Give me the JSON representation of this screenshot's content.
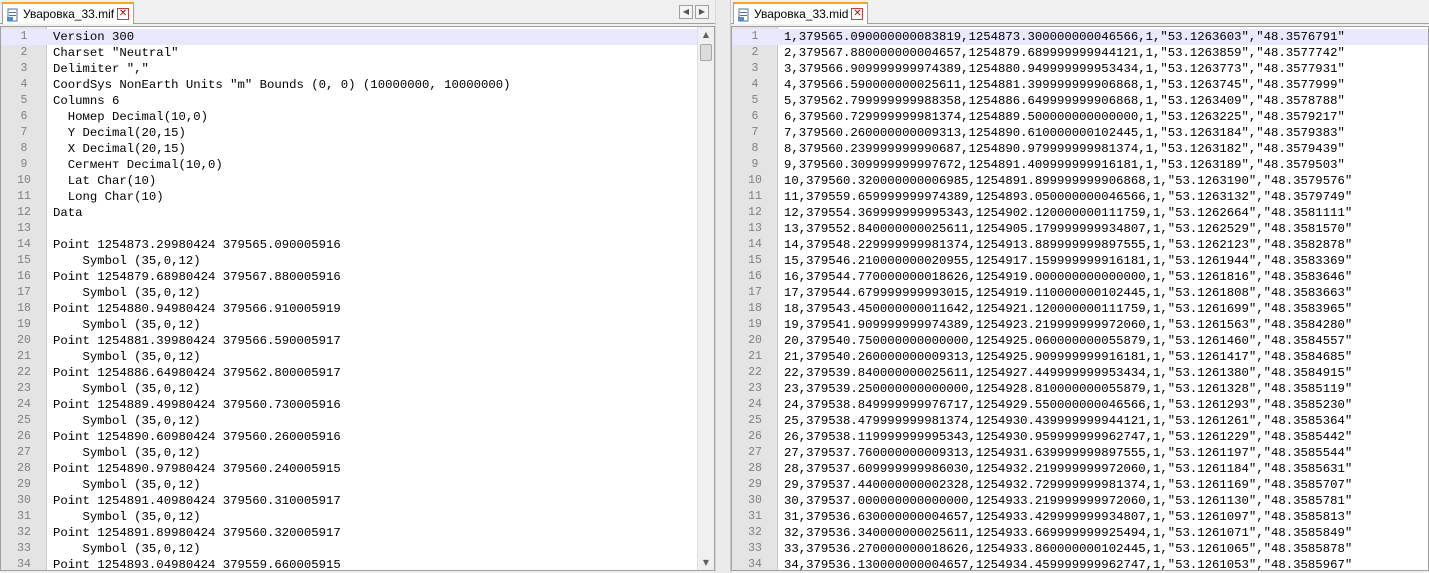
{
  "left_pane": {
    "tab_title": "Уваровка_33.mif",
    "close_glyph": "✕",
    "nav_prev": "◀",
    "nav_next": "▶",
    "scroll_up": "▲",
    "scroll_down": "▼",
    "lines": [
      {
        "n": "1",
        "text": "Version 300"
      },
      {
        "n": "2",
        "text": "Charset \"Neutral\""
      },
      {
        "n": "3",
        "text": "Delimiter \",\""
      },
      {
        "n": "4",
        "text": "CoordSys NonEarth Units \"m\" Bounds (0, 0) (10000000, 10000000)"
      },
      {
        "n": "5",
        "text": "Columns 6"
      },
      {
        "n": "6",
        "text": "  Номер Decimal(10,0)"
      },
      {
        "n": "7",
        "text": "  Y Decimal(20,15)"
      },
      {
        "n": "8",
        "text": "  X Decimal(20,15)"
      },
      {
        "n": "9",
        "text": "  Сегмент Decimal(10,0)"
      },
      {
        "n": "10",
        "text": "  Lat Char(10)"
      },
      {
        "n": "11",
        "text": "  Long Char(10)"
      },
      {
        "n": "12",
        "text": "Data"
      },
      {
        "n": "13",
        "text": ""
      },
      {
        "n": "14",
        "text": "Point 1254873.29980424 379565.090005916"
      },
      {
        "n": "15",
        "text": "    Symbol (35,0,12)"
      },
      {
        "n": "16",
        "text": "Point 1254879.68980424 379567.880005916"
      },
      {
        "n": "17",
        "text": "    Symbol (35,0,12)"
      },
      {
        "n": "18",
        "text": "Point 1254880.94980424 379566.910005919"
      },
      {
        "n": "19",
        "text": "    Symbol (35,0,12)"
      },
      {
        "n": "20",
        "text": "Point 1254881.39980424 379566.590005917"
      },
      {
        "n": "21",
        "text": "    Symbol (35,0,12)"
      },
      {
        "n": "22",
        "text": "Point 1254886.64980424 379562.800005917"
      },
      {
        "n": "23",
        "text": "    Symbol (35,0,12)"
      },
      {
        "n": "24",
        "text": "Point 1254889.49980424 379560.730005916"
      },
      {
        "n": "25",
        "text": "    Symbol (35,0,12)"
      },
      {
        "n": "26",
        "text": "Point 1254890.60980424 379560.260005916"
      },
      {
        "n": "27",
        "text": "    Symbol (35,0,12)"
      },
      {
        "n": "28",
        "text": "Point 1254890.97980424 379560.240005915"
      },
      {
        "n": "29",
        "text": "    Symbol (35,0,12)"
      },
      {
        "n": "30",
        "text": "Point 1254891.40980424 379560.310005917"
      },
      {
        "n": "31",
        "text": "    Symbol (35,0,12)"
      },
      {
        "n": "32",
        "text": "Point 1254891.89980424 379560.320005917"
      },
      {
        "n": "33",
        "text": "    Symbol (35,0,12)"
      },
      {
        "n": "34",
        "text": "Point 1254893.04980424 379559.660005915"
      }
    ]
  },
  "right_pane": {
    "tab_title": "Уваровка_33.mid",
    "close_glyph": "✕",
    "lines": [
      {
        "n": "1",
        "text": "1,379565.090000000083819,1254873.300000000046566,1,\"53.1263603\",\"48.3576791\""
      },
      {
        "n": "2",
        "text": "2,379567.880000000004657,1254879.689999999944121,1,\"53.1263859\",\"48.3577742\""
      },
      {
        "n": "3",
        "text": "3,379566.909999999974389,1254880.949999999953434,1,\"53.1263773\",\"48.3577931\""
      },
      {
        "n": "4",
        "text": "4,379566.590000000025611,1254881.399999999906868,1,\"53.1263745\",\"48.3577999\""
      },
      {
        "n": "5",
        "text": "5,379562.799999999988358,1254886.649999999906868,1,\"53.1263409\",\"48.3578788\""
      },
      {
        "n": "6",
        "text": "6,379560.729999999981374,1254889.500000000000000,1,\"53.1263225\",\"48.3579217\""
      },
      {
        "n": "7",
        "text": "7,379560.260000000009313,1254890.610000000102445,1,\"53.1263184\",\"48.3579383\""
      },
      {
        "n": "8",
        "text": "8,379560.239999999990687,1254890.979999999981374,1,\"53.1263182\",\"48.3579439\""
      },
      {
        "n": "9",
        "text": "9,379560.309999999997672,1254891.409999999916181,1,\"53.1263189\",\"48.3579503\""
      },
      {
        "n": "10",
        "text": "10,379560.320000000006985,1254891.899999999906868,1,\"53.1263190\",\"48.3579576\""
      },
      {
        "n": "11",
        "text": "11,379559.659999999974389,1254893.050000000046566,1,\"53.1263132\",\"48.3579749\""
      },
      {
        "n": "12",
        "text": "12,379554.369999999995343,1254902.120000000111759,1,\"53.1262664\",\"48.3581111\""
      },
      {
        "n": "13",
        "text": "13,379552.840000000025611,1254905.179999999934807,1,\"53.1262529\",\"48.3581570\""
      },
      {
        "n": "14",
        "text": "14,379548.229999999981374,1254913.889999999897555,1,\"53.1262123\",\"48.3582878\""
      },
      {
        "n": "15",
        "text": "15,379546.210000000020955,1254917.159999999916181,1,\"53.1261944\",\"48.3583369\""
      },
      {
        "n": "16",
        "text": "16,379544.770000000018626,1254919.000000000000000,1,\"53.1261816\",\"48.3583646\""
      },
      {
        "n": "17",
        "text": "17,379544.679999999993015,1254919.110000000102445,1,\"53.1261808\",\"48.3583663\""
      },
      {
        "n": "18",
        "text": "18,379543.450000000011642,1254921.120000000111759,1,\"53.1261699\",\"48.3583965\""
      },
      {
        "n": "19",
        "text": "19,379541.909999999974389,1254923.219999999972060,1,\"53.1261563\",\"48.3584280\""
      },
      {
        "n": "20",
        "text": "20,379540.750000000000000,1254925.060000000055879,1,\"53.1261460\",\"48.3584557\""
      },
      {
        "n": "21",
        "text": "21,379540.260000000009313,1254925.909999999916181,1,\"53.1261417\",\"48.3584685\""
      },
      {
        "n": "22",
        "text": "22,379539.840000000025611,1254927.449999999953434,1,\"53.1261380\",\"48.3584915\""
      },
      {
        "n": "23",
        "text": "23,379539.250000000000000,1254928.810000000055879,1,\"53.1261328\",\"48.3585119\""
      },
      {
        "n": "24",
        "text": "24,379538.849999999976717,1254929.550000000046566,1,\"53.1261293\",\"48.3585230\""
      },
      {
        "n": "25",
        "text": "25,379538.479999999981374,1254930.439999999944121,1,\"53.1261261\",\"48.3585364\""
      },
      {
        "n": "26",
        "text": "26,379538.119999999995343,1254930.959999999962747,1,\"53.1261229\",\"48.3585442\""
      },
      {
        "n": "27",
        "text": "27,379537.760000000009313,1254931.639999999897555,1,\"53.1261197\",\"48.3585544\""
      },
      {
        "n": "28",
        "text": "28,379537.609999999986030,1254932.219999999972060,1,\"53.1261184\",\"48.3585631\""
      },
      {
        "n": "29",
        "text": "29,379537.440000000002328,1254932.729999999981374,1,\"53.1261169\",\"48.3585707\""
      },
      {
        "n": "30",
        "text": "30,379537.000000000000000,1254933.219999999972060,1,\"53.1261130\",\"48.3585781\""
      },
      {
        "n": "31",
        "text": "31,379536.630000000004657,1254933.429999999934807,1,\"53.1261097\",\"48.3585813\""
      },
      {
        "n": "32",
        "text": "32,379536.340000000025611,1254933.669999999925494,1,\"53.1261071\",\"48.3585849\""
      },
      {
        "n": "33",
        "text": "33,379536.270000000018626,1254933.860000000102445,1,\"53.1261065\",\"48.3585878\""
      },
      {
        "n": "34",
        "text": "34,379536.130000000004657,1254934.459999999962747,1,\"53.1261053\",\"48.3585967\""
      }
    ]
  }
}
